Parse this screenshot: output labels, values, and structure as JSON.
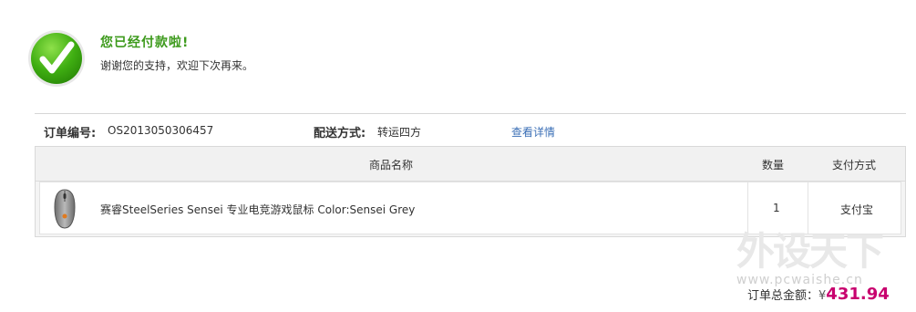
{
  "success": {
    "title": "您已经付款啦!",
    "subtitle": "谢谢您的支持，欢迎下次再来。",
    "icon": "checkmark-icon",
    "color": "#3d9a1c"
  },
  "order": {
    "number_label": "订单编号:",
    "number_value": "OS2013050306457",
    "shipping_label": "配送方式:",
    "shipping_value": "转运四方",
    "details_link": "查看详情"
  },
  "table": {
    "headers": {
      "name": "商品名称",
      "quantity": "数量",
      "payment": "支付方式"
    },
    "rows": [
      {
        "icon": "mouse-icon",
        "name": "赛睿SteelSeries Sensei 专业电竞游戏鼠标 Color:Sensei Grey",
        "quantity": "1",
        "payment": "支付宝"
      }
    ]
  },
  "total": {
    "label": "订单总金额：",
    "currency": "¥",
    "amount": "431.94",
    "color": "#c8006e"
  },
  "watermark": {
    "text": "外设天下",
    "url": "www.pcwaishe.cn"
  }
}
